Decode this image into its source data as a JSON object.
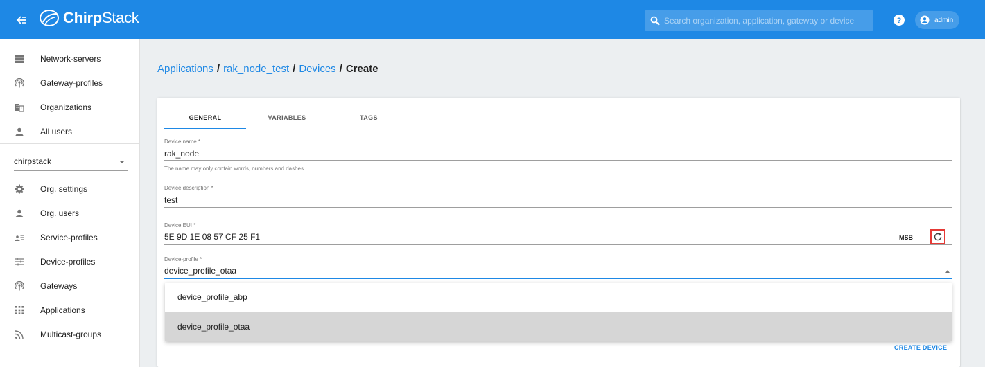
{
  "app": {
    "logo_text_bold": "Chirp",
    "logo_text_rest": "Stack"
  },
  "search": {
    "placeholder": "Search organization, application, gateway or device"
  },
  "user": {
    "name": "admin"
  },
  "sidebar": {
    "admin_items": [
      {
        "label": "Network-servers",
        "icon": "server-icon"
      },
      {
        "label": "Gateway-profiles",
        "icon": "radio-tower-icon"
      },
      {
        "label": "Organizations",
        "icon": "domain-icon"
      },
      {
        "label": "All users",
        "icon": "account-icon"
      }
    ],
    "org_selector": {
      "value": "chirpstack"
    },
    "org_items": [
      {
        "label": "Org. settings",
        "icon": "gear-icon"
      },
      {
        "label": "Org. users",
        "icon": "account-icon"
      },
      {
        "label": "Service-profiles",
        "icon": "account-details-icon"
      },
      {
        "label": "Device-profiles",
        "icon": "tune-icon"
      },
      {
        "label": "Gateways",
        "icon": "radio-tower-icon"
      },
      {
        "label": "Applications",
        "icon": "apps-grid-icon"
      },
      {
        "label": "Multicast-groups",
        "icon": "rss-icon"
      }
    ]
  },
  "breadcrumb": {
    "items": [
      "Applications",
      "rak_node_test",
      "Devices"
    ],
    "separator": "/",
    "current": "Create"
  },
  "tabs": [
    "GENERAL",
    "VARIABLES",
    "TAGS"
  ],
  "form": {
    "device_name": {
      "label": "Device name *",
      "value": "rak_node",
      "helper": "The name may only contain words, numbers and dashes."
    },
    "device_description": {
      "label": "Device description *",
      "value": "test"
    },
    "device_eui": {
      "label": "Device EUI *",
      "value": "5E 9D 1E 08 57 CF 25 F1",
      "byte_order": "MSB"
    },
    "device_profile": {
      "label": "Device-profile *",
      "value": "device_profile_otaa",
      "options": [
        "device_profile_abp",
        "device_profile_otaa"
      ],
      "selected_index": 1
    }
  },
  "actions": {
    "create_label": "CREATE DEVICE"
  },
  "colors": {
    "primary": "#1e88e5",
    "highlight": "#e53935"
  }
}
